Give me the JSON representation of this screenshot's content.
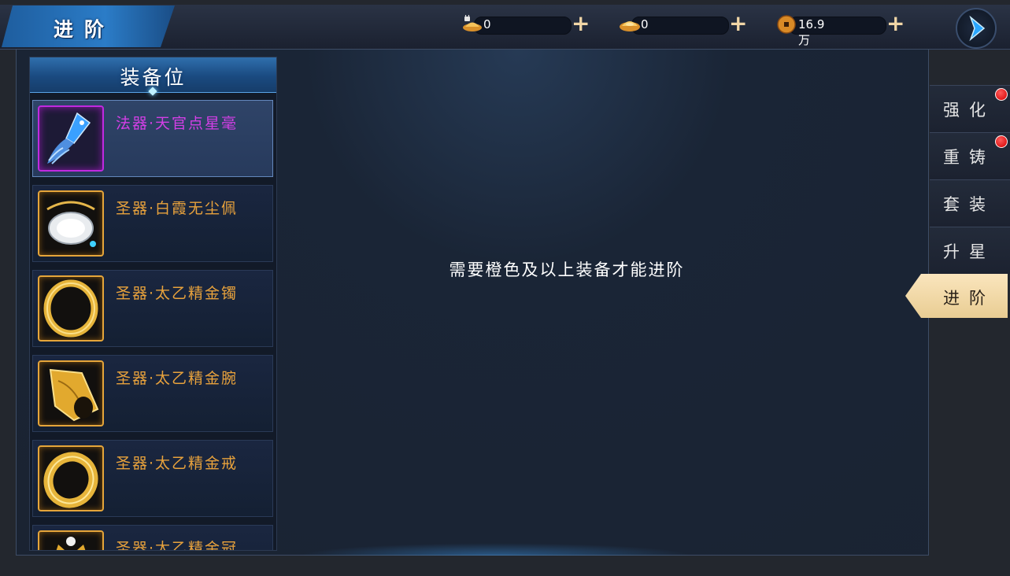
{
  "header": {
    "title": "进阶",
    "currencies": [
      {
        "icon": "locked-ingot-icon",
        "value": "0"
      },
      {
        "icon": "ingot-icon",
        "value": "0"
      },
      {
        "icon": "copper-coin-icon",
        "value": "16.9万"
      }
    ],
    "next_icon": "chevron-right-icon"
  },
  "list": {
    "header": "装备位",
    "items": [
      {
        "name": "法器·天官点星毫",
        "icon": "magic-brush-icon",
        "quality": "purple"
      },
      {
        "name": "圣器·白霞无尘佩",
        "icon": "jade-pendant-icon",
        "quality": "orange"
      },
      {
        "name": "圣器·太乙精金镯",
        "icon": "gold-bracelet-icon",
        "quality": "orange"
      },
      {
        "name": "圣器·太乙精金腕",
        "icon": "gold-bracer-icon",
        "quality": "orange"
      },
      {
        "name": "圣器·太乙精金戒",
        "icon": "gold-ring-icon",
        "quality": "orange"
      },
      {
        "name": "圣器·太乙精金冠",
        "icon": "gold-crown-icon",
        "quality": "orange"
      }
    ]
  },
  "main": {
    "message": "需要橙色及以上装备才能进阶"
  },
  "tabs": [
    {
      "label": "强化",
      "badge": true
    },
    {
      "label": "重铸",
      "badge": true
    },
    {
      "label": "套装",
      "badge": false
    },
    {
      "label": "升星",
      "badge": false
    },
    {
      "label": "进阶",
      "badge": false,
      "active": true
    }
  ],
  "colors": {
    "accent_blue": "#2b7cc7",
    "purple_quality": "#d33fe6",
    "orange_quality": "#e8a23c",
    "active_tab": "#f5dcab",
    "badge_red": "#d40000"
  }
}
